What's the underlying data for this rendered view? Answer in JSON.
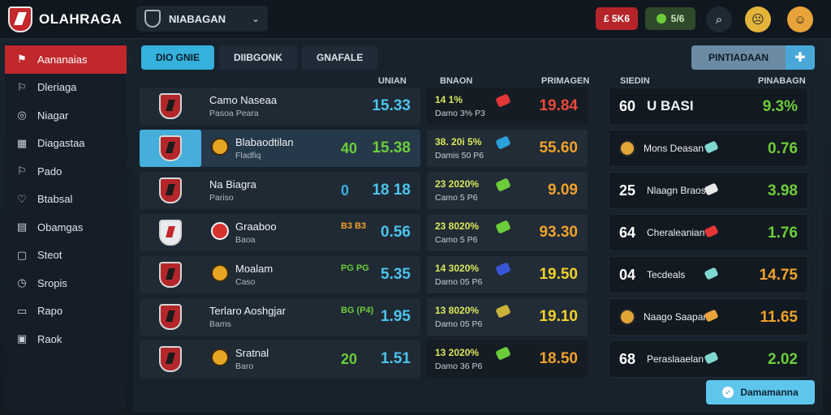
{
  "app": {
    "title": "OLAHRAGA"
  },
  "header": {
    "selector_label": "NIABAGAN",
    "badge_red": "£ 5K6",
    "badge_green": "5/6"
  },
  "colors": {
    "accent_red": "#c0282c",
    "accent_blue": "#36b0dc",
    "green": "#6ccd3a",
    "orange": "#f0a12a"
  },
  "icons": {
    "brand": "shield-crest-icon",
    "selector": "shield-outline-icon",
    "search": "search-icon",
    "avatar": "face-avatar-icon",
    "plus": "plus-icon",
    "check": "check-icon"
  },
  "sidebar": {
    "items": [
      {
        "label": "Aananaias",
        "icon": "flag-icon",
        "glyph": "⚑",
        "active": true
      },
      {
        "label": "Dleriaga",
        "icon": "flag-icon",
        "glyph": "⚐"
      },
      {
        "label": "Niagar",
        "icon": "target-icon",
        "glyph": "◎"
      },
      {
        "label": "Diagastaa",
        "icon": "grid-icon",
        "glyph": "▦"
      },
      {
        "label": "Pado",
        "icon": "flag-icon",
        "glyph": "⚐"
      },
      {
        "label": "Btabsal",
        "icon": "heart-icon",
        "glyph": "♡"
      },
      {
        "label": "Obamgas",
        "icon": "chart-icon",
        "glyph": "▤"
      },
      {
        "label": "Steot",
        "icon": "shield-icon",
        "glyph": "▢"
      },
      {
        "label": "Sropis",
        "icon": "clock-icon",
        "glyph": "◷"
      },
      {
        "label": "Rapo",
        "icon": "page-icon",
        "glyph": "▭"
      },
      {
        "label": "Raok",
        "icon": "lock-icon",
        "glyph": "▣"
      }
    ]
  },
  "tabs": [
    {
      "label": "DIO GNIE",
      "active": true
    },
    {
      "label": "DIIBGONK"
    },
    {
      "label": "GNAFALE"
    }
  ],
  "action": {
    "label": "PINTIADAAN"
  },
  "columns": {
    "c1": "UNIAN",
    "c2": "BNAON",
    "c3": "PRIMAGEN",
    "c4": "SIEDIN",
    "c5": "PINABAGN"
  },
  "rows": [
    {
      "team": "Camo Naseaa",
      "sub": "Pasoa Peara",
      "mid": "",
      "score": "15.33",
      "b_top": "14 1%",
      "b_bot": "Damo   3%    P3",
      "odds": "19.84",
      "c_num": "60",
      "c_name": "U BASI",
      "c_val": "9.3%"
    },
    {
      "team": "Blabaodtilan",
      "sub": "Fladfiq",
      "mid": "40",
      "score": "15.38",
      "b_top": "38. 20i 5%",
      "b_bot": "Damis  50   P6",
      "odds": "55.60",
      "c_num": "",
      "c_name": "Mons Deasan",
      "c_val": "0.76"
    },
    {
      "team": "Na Biagra",
      "sub": "Pariso",
      "mid": "0",
      "score": "18 18",
      "b_top": "23 2020%",
      "b_bot": "Camo   5   P6",
      "odds": "9.09",
      "c_num": "25",
      "c_name": "Nlaagn Braoso",
      "c_val": "3.98"
    },
    {
      "team": "Graaboo",
      "sub": "Baoa",
      "mid": "B3 B3",
      "score": "0.56",
      "b_top": "23 8020%",
      "b_bot": "Camo  5   P6",
      "odds": "93.30",
      "c_num": "64",
      "c_name": "Cheraleanian",
      "c_val": "1.76"
    },
    {
      "team": "Moalam",
      "sub": "Caso",
      "mid": "PG PG",
      "score": "5.35",
      "b_top": "14 3020%",
      "b_bot": "Damo  05   P6",
      "odds": "19.50",
      "c_num": "04",
      "c_name": "Tecdeals",
      "c_val": "14.75"
    },
    {
      "team": "Terlaro Aoshgjar",
      "sub": "Bams",
      "mid": "BG (P4)",
      "score": "1.95",
      "b_top": "13 8020%",
      "b_bot": "Damo  05   P6",
      "odds": "19.10",
      "c_num": "",
      "c_name": "Naago Saapan",
      "c_val": "11.65"
    },
    {
      "team": "Sratnal",
      "sub": "Baro",
      "mid": "20",
      "score": "1.51",
      "b_top": "13 2020%",
      "b_bot": "Damo  36   P6",
      "odds": "18.50",
      "c_num": "68",
      "c_name": "Peraslaaelan",
      "c_val": "2.02"
    }
  ],
  "float_button": {
    "label": "Damamanna"
  }
}
